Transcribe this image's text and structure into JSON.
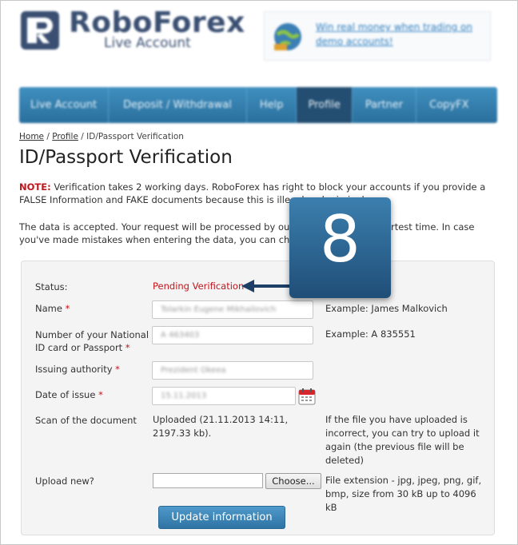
{
  "header": {
    "logo_text": "RoboForex",
    "logo_sub": "Live Account",
    "promo_text": "Win real money when trading on demo accounts!"
  },
  "nav": {
    "items": [
      "Live Account",
      "Deposit / Withdrawal",
      "Help",
      "Profile",
      "Partner",
      "CopyFX"
    ],
    "active_index": 3
  },
  "breadcrumb": {
    "home": "Home",
    "sep1": "/",
    "profile": "Profile",
    "sep2": "/",
    "current": "ID/Passport Verification"
  },
  "page_title": "ID/Passport Verification",
  "note": {
    "label": "NOTE:",
    "text": " Verification takes 2 working days. RoboForex has right to block your accounts if you provide a FALSE Information and FAKE documents because this is illegal and criminal."
  },
  "accepted_text": "The data is accepted. Your request will be processed by our managers in the shortest time. In case you've made mistakes when entering the data, you can change it.",
  "form": {
    "status_label": "Status:",
    "status_value": "Pending Verification",
    "name_label": "Name",
    "name_value": "Tolarkin Eugene Mikhailovich",
    "name_example": "Example: James Malkovich",
    "idnum_label_1": "Number of your National",
    "idnum_label_2": "ID card or Passport",
    "idnum_value": "A 463403",
    "idnum_example": "Example: A 835551",
    "authority_label": "Issuing authority",
    "authority_value": "Prezident Okeea",
    "date_label": "Date of issue",
    "date_value": "15.11.2013",
    "scan_label": "Scan of the document",
    "uploaded_text": "Uploaded (21.11.2013 14:11, 2197.33 kb).",
    "reupload_text": "If the file you have uploaded is incorrect, you can try to upload it again (the previous file will be deleted)",
    "upload_label": "Upload new?",
    "choose_label": "Choose...",
    "ext_text": "File extension - jpg, jpeg, png, gif, bmp, size from 30 kB up to 4096 kB",
    "required_mark": "*",
    "update_label": "Update information"
  },
  "badge": {
    "number": "8"
  },
  "colors": {
    "nav_bg": "#3a86b8",
    "nav_active": "#234e72",
    "accent_red": "#c0151b",
    "badge_bg": "#2d6797"
  }
}
